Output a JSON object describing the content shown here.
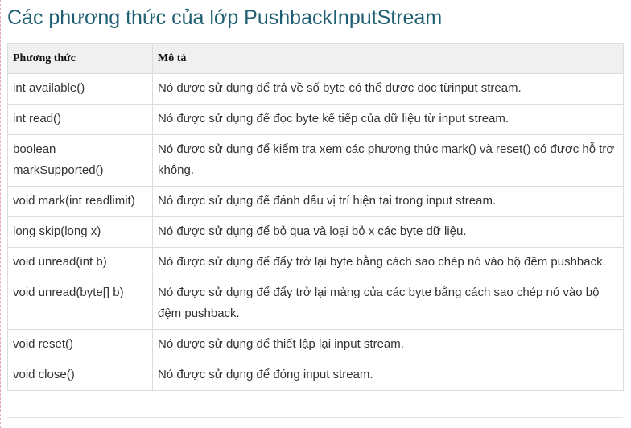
{
  "page": {
    "title": "Các phương thức của lớp PushbackInputStream"
  },
  "table": {
    "headers": [
      "Phương thức",
      "Mô tả"
    ],
    "rows": [
      {
        "method": "int available()",
        "description": "Nó được sử dụng để trả về số byte có thể được đọc từinput stream."
      },
      {
        "method": "int read()",
        "description": "Nó được sử dụng để đọc byte kế tiếp của dữ liệu từ input stream."
      },
      {
        "method": "boolean markSupported()",
        "description": "Nó được sử dụng để kiểm tra xem các phương thức mark() và reset() có được hỗ trợ không."
      },
      {
        "method": "void mark(int readlimit)",
        "description": "Nó được sử dụng để đánh dấu vị trí hiện tại trong input stream."
      },
      {
        "method": "long skip(long x)",
        "description": "Nó được sử dụng để bỏ qua và loại bỏ x các byte dữ liệu."
      },
      {
        "method": "void unread(int b)",
        "description": "Nó được sử dụng để đẩy trở lại byte bằng cách sao chép nó vào bộ đệm pushback."
      },
      {
        "method": "void unread(byte[] b)",
        "description": "Nó được sử dụng để đẩy trở lại mảng của các byte bằng cách sao chép nó vào bộ đệm pushback."
      },
      {
        "method": "void reset()",
        "description": "Nó được sử dụng để thiết lập lại input stream."
      },
      {
        "method": "void close()",
        "description": "Nó được sử dụng để đóng input stream."
      }
    ]
  },
  "colors": {
    "title": "#1f5f73",
    "header_background": "#f0f0f0",
    "border": "#dddddd"
  }
}
